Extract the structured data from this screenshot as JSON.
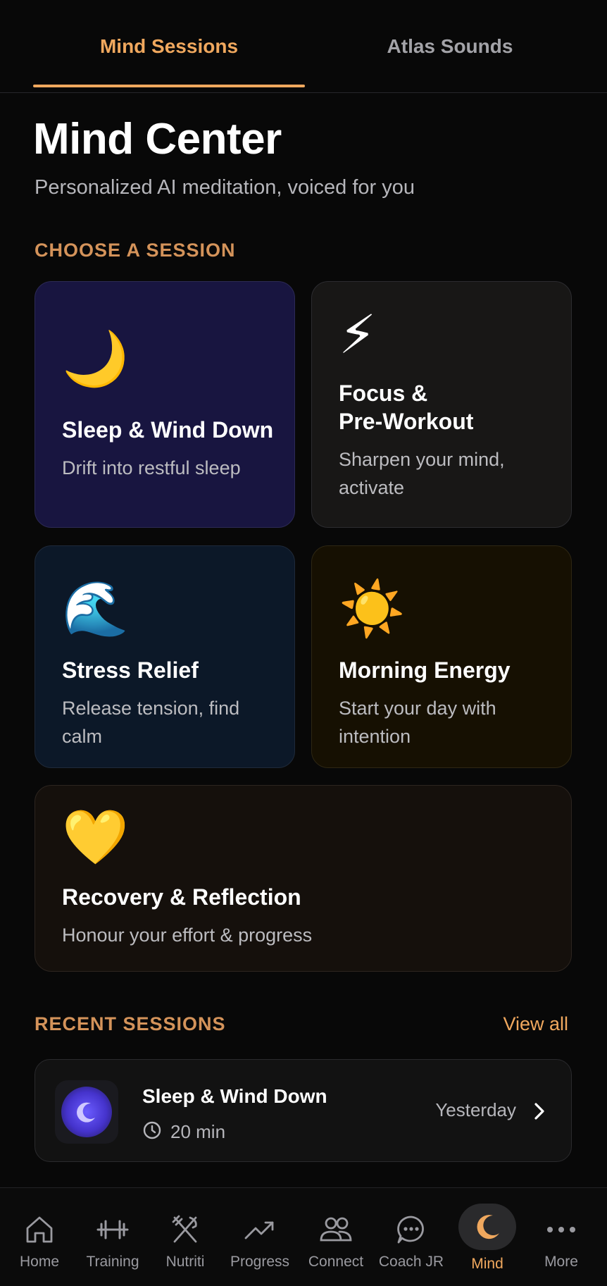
{
  "tabs": [
    {
      "label": "Mind Sessions",
      "active": true
    },
    {
      "label": "Atlas Sounds",
      "active": false
    }
  ],
  "header": {
    "title": "Mind Center",
    "subtitle": "Personalized AI meditation, voiced for you"
  },
  "sessions": {
    "section_label": "CHOOSE A SESSION",
    "cards": [
      {
        "id": "sleep",
        "emoji": "🌙",
        "icon": "crescent-moon-icon",
        "title": "Sleep & Wind Down",
        "description": "Drift into restful sleep",
        "color": "#181540"
      },
      {
        "id": "focus",
        "emoji": "⚡",
        "icon": "lightning-icon",
        "title_line1": "Focus &",
        "title_line2": "Pre-Workout",
        "description_line1": "Sharpen your mind,",
        "description_line2": "activate",
        "color": "#181716"
      },
      {
        "id": "stress",
        "emoji": "🌊",
        "icon": "wave-icon",
        "title": "Stress Relief",
        "description_line1": "Release tension, find",
        "description_line2": "calm",
        "color": "#0c1828"
      },
      {
        "id": "morning",
        "emoji": "☀️",
        "icon": "sun-icon",
        "title": "Morning Energy",
        "description_line1": "Start your day with",
        "description_line2": "intention",
        "color": "#161002"
      },
      {
        "id": "recovery",
        "emoji": "💛",
        "icon": "yellow-heart-icon",
        "title": "Recovery & Reflection",
        "description": "Honour your effort & progress",
        "color": "#15100c"
      }
    ]
  },
  "recent": {
    "section_label": "RECENT SESSIONS",
    "view_all_label": "View all",
    "items": [
      {
        "title": "Sleep & Wind Down",
        "duration": "20 min",
        "when": "Yesterday",
        "icon": "moon-icon"
      }
    ]
  },
  "nav": {
    "items": [
      {
        "label": "Home",
        "icon": "home-icon"
      },
      {
        "label": "Training",
        "icon": "dumbbell-icon"
      },
      {
        "label": "Nutriti",
        "icon": "fork-knife-icon"
      },
      {
        "label": "Progress",
        "icon": "trend-up-icon"
      },
      {
        "label": "Connect",
        "icon": "people-icon"
      },
      {
        "label": "Coach JR",
        "icon": "chat-bubble-icon"
      },
      {
        "label": "Mind",
        "icon": "moon-icon",
        "active": true
      },
      {
        "label": "More",
        "icon": "more-dots-icon"
      }
    ]
  },
  "colors": {
    "accent": "#f0a85e",
    "section_label": "#d4935a",
    "background": "#080808"
  }
}
